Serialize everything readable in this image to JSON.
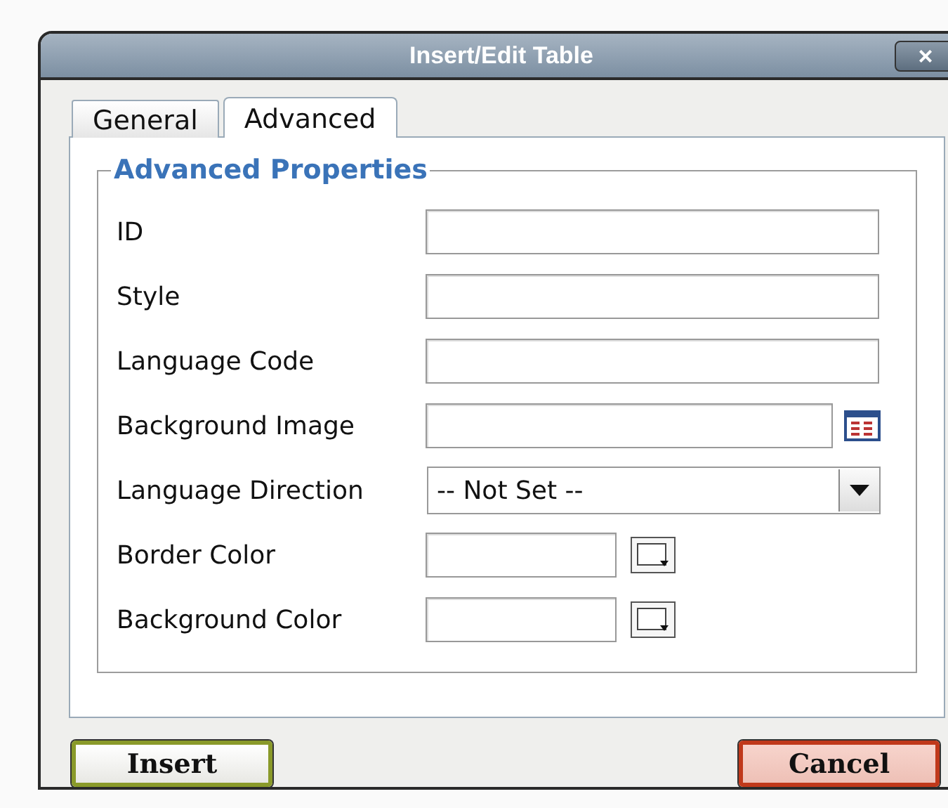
{
  "window": {
    "title": "Insert/Edit Table",
    "close": "×"
  },
  "tabs": [
    {
      "label": "General",
      "selected": false
    },
    {
      "label": "Advanced",
      "selected": true
    }
  ],
  "fieldset": {
    "legend": "Advanced Properties",
    "rows": [
      {
        "kind": "text",
        "label": "ID"
      },
      {
        "kind": "text",
        "label": "Style"
      },
      {
        "kind": "text",
        "label": "Language Code"
      },
      {
        "kind": "browse",
        "label": "Background Image"
      },
      {
        "kind": "select",
        "label": "Language Direction",
        "value": "-- Not Set --"
      },
      {
        "kind": "color",
        "label": "Border Color"
      },
      {
        "kind": "color",
        "label": "Background Color"
      }
    ]
  },
  "buttons": [
    {
      "kind": "insert",
      "label": "Insert"
    },
    {
      "kind": "cancel",
      "label": "Cancel"
    }
  ]
}
